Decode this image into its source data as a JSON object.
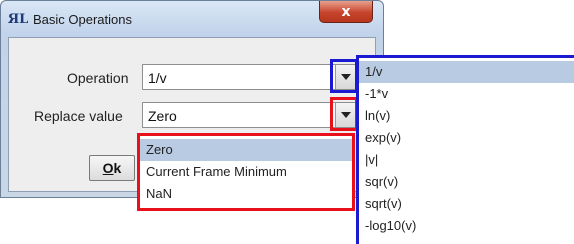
{
  "window": {
    "title": "Basic Operations",
    "app_icon_glyph": "ЯL",
    "close_glyph": "x"
  },
  "form": {
    "operation_label": "Operation",
    "operation_value": "1/v",
    "replace_label": "Replace value",
    "replace_value": "Zero",
    "ok_label": "k",
    "ok_mnemonic": "O"
  },
  "replace_dropdown": {
    "items": [
      "Zero",
      "Current Frame Minimum",
      "NaN"
    ],
    "selected_index": 0
  },
  "operation_dropdown": {
    "items": [
      "1/v",
      "-1*v",
      "ln(v)",
      "exp(v)",
      "|v|",
      "sqr(v)",
      "sqrt(v)",
      "-log10(v)"
    ],
    "selected_index": 0
  },
  "colors": {
    "highlight_red": "#e8101a",
    "highlight_blue": "#1a1ad0",
    "selection_bg": "#b8cbe2"
  }
}
